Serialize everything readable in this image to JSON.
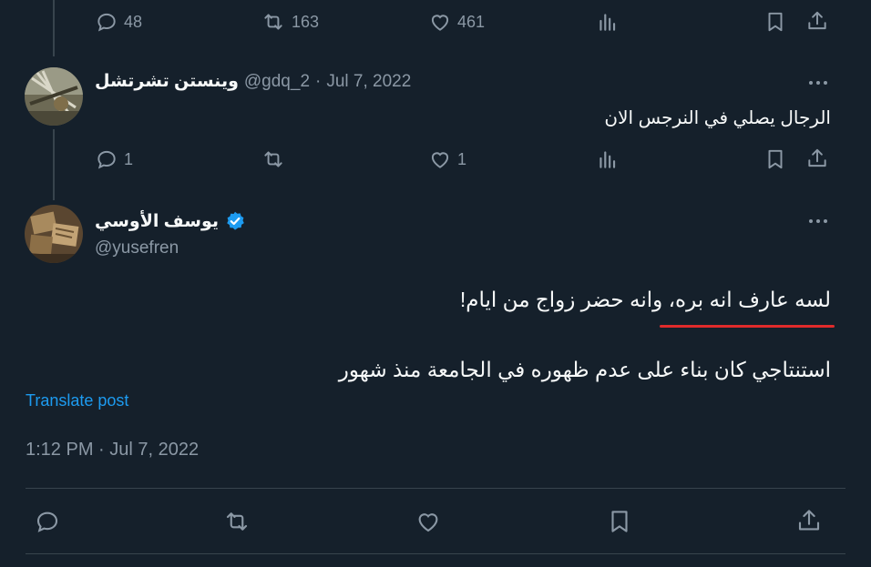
{
  "top_actions": {
    "reply_count": "48",
    "retweet_count": "163",
    "like_count": "461"
  },
  "reply_tweet": {
    "display_name": "وينستن تشرتشل",
    "handle": "@gdq_2",
    "separator": "·",
    "date": "Jul 7, 2022",
    "text": "الرجال يصلي في النرجس الان",
    "reply_count": "1",
    "like_count": "1"
  },
  "main_tweet": {
    "display_name": "يوسف الأوسي",
    "handle": "@yusefren",
    "verified": true,
    "line1": "لسه عارف انه بره، وانه حضر زواج من ايام!",
    "line2": "استنتاجي كان بناء على عدم ظهوره في الجامعة منذ شهور",
    "translate_label": "Translate post",
    "timestamp": "1:12 PM · Jul 7, 2022"
  },
  "colors": {
    "background": "#15202b",
    "muted": "#8b98a5",
    "accent": "#1d9bf0",
    "annotation": "#e02b2b"
  },
  "icons": [
    "reply-icon",
    "retweet-icon",
    "like-icon",
    "views-icon",
    "bookmark-icon",
    "share-icon",
    "more-icon",
    "verified-icon"
  ]
}
